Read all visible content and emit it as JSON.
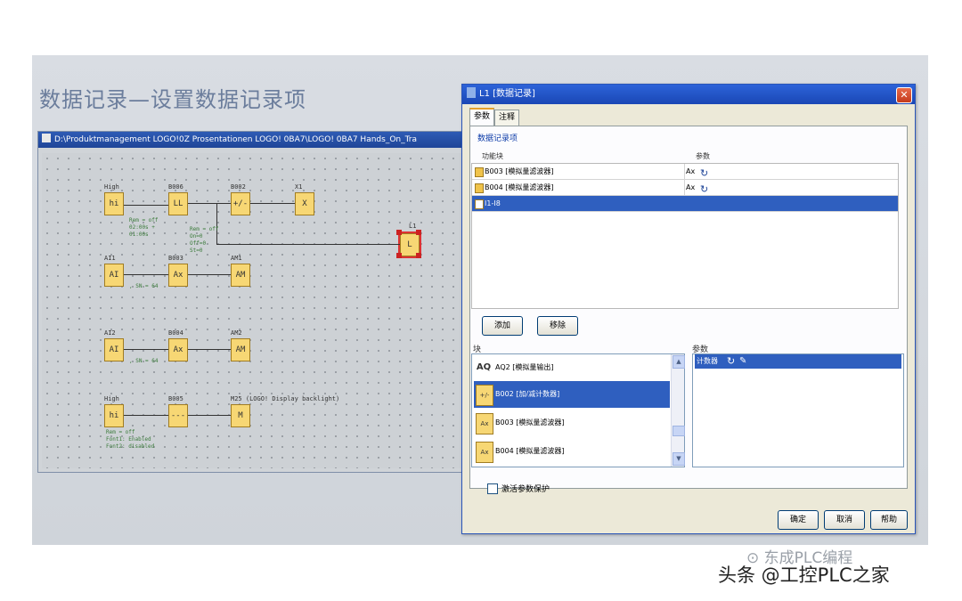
{
  "slide": {
    "title": "数据记录—设置数据记录项"
  },
  "logo_window": {
    "title": "D:\\Produktmanagement LOGO!0Z Prosentationen LOGO! 0BA7\\LOGO! 0BA7 Hands_On_Tra",
    "blocks": [
      {
        "label": "High",
        "text": "hi"
      },
      {
        "label": "B006",
        "text": "LL"
      },
      {
        "label": "B002",
        "text": "+/-"
      },
      {
        "label": "X1",
        "text": "X"
      },
      {
        "label": "L1",
        "text": "L"
      },
      {
        "label": "AI1",
        "text": "AI"
      },
      {
        "label": "B003",
        "text": "Ax"
      },
      {
        "label": "AM1",
        "text": "AM"
      },
      {
        "label": "AI2",
        "text": "AI"
      },
      {
        "label": "B004",
        "text": "Ax"
      },
      {
        "label": "AM2",
        "text": "AM"
      },
      {
        "label": "High",
        "text": "hi"
      },
      {
        "label": "B005",
        "text": "---"
      },
      {
        "label": "M25 (LOGO! Display backlight)",
        "text": "M"
      }
    ],
    "params": {
      "p1": "Rem = off\n02:00s +\n01:00s",
      "p2": "Rem = off\nOn=0\nOff=0\nSt=0",
      "p3": ", SN = 64",
      "p4": ", SN = 64",
      "p5": "Rem = off\nFont1: Enabled\nFont2: disabled"
    }
  },
  "dialog": {
    "title": "L1 [数据记录]",
    "close": "✕",
    "tabs": [
      {
        "label": "参数"
      },
      {
        "label": "注释"
      }
    ],
    "group_datalog": "数据记录项",
    "columns": {
      "fb": "功能块",
      "param": "参数"
    },
    "rows": [
      {
        "fb": "B003 [模拟量滤波器]",
        "param": "Ax"
      },
      {
        "fb": "B004 [模拟量滤波器]",
        "param": "Ax"
      },
      {
        "fb": "I1-I8",
        "param": ""
      }
    ],
    "add_button": "添加",
    "remove_button": "移除",
    "group_block": "块",
    "group_param": "参数",
    "block_list": [
      {
        "icon": "AQ",
        "text": "AQ2 [模拟量输出]"
      },
      {
        "icon": "+/-",
        "text": "B002 [加/减计数器]"
      },
      {
        "icon": "Ax",
        "text": "B003 [模拟量滤波器]"
      },
      {
        "icon": "Ax",
        "text": "B004 [模拟量滤波器]"
      }
    ],
    "param_list": [
      {
        "text": "计数器"
      }
    ],
    "checkbox_label": "激活参数保护",
    "ok_button": "确定",
    "cancel_button": "取消",
    "help_button": "帮助"
  },
  "watermark": {
    "main": "头条 @工控PLC之家",
    "secondary": "⊙ 东成PLC编程"
  },
  "colors": {
    "titlebar": "#1f4598",
    "selection": "#2f5fbf",
    "block": "#f7d774"
  }
}
